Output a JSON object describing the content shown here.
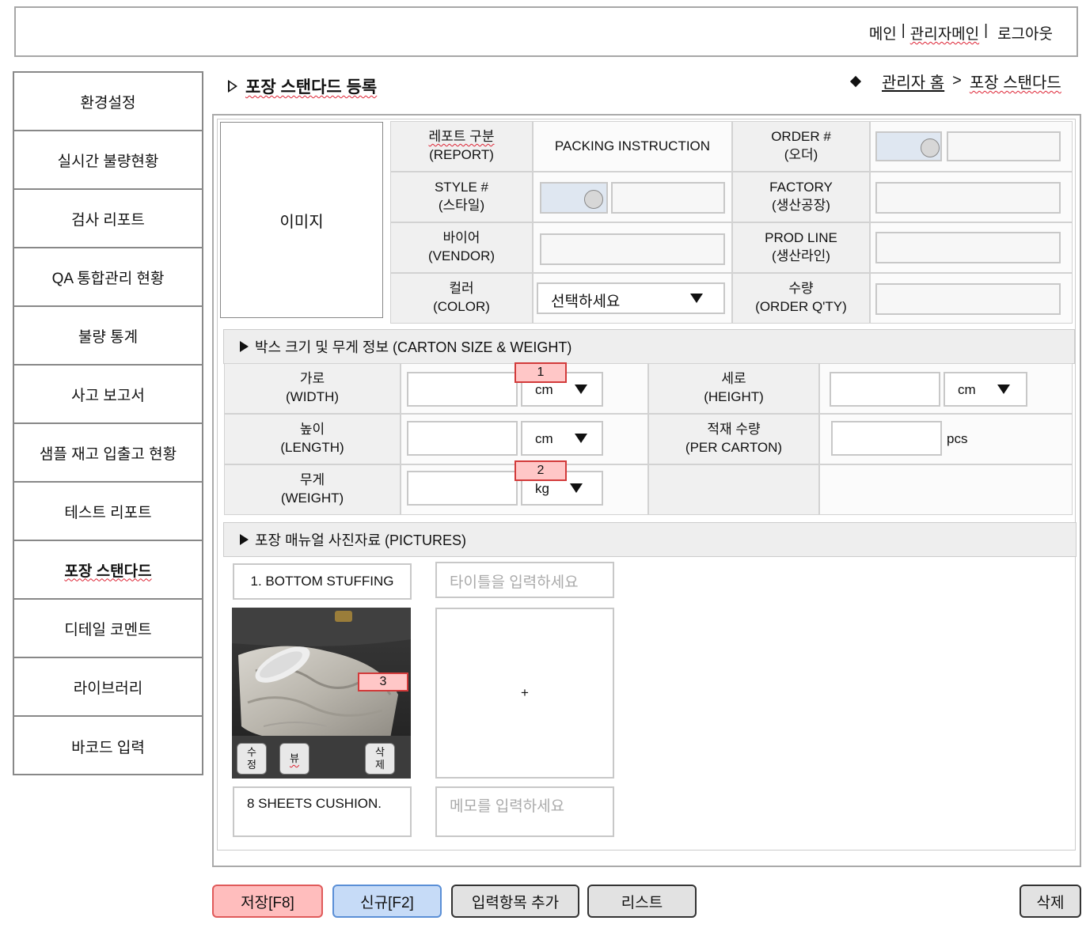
{
  "header": {
    "links": [
      "메인",
      "관리자메인",
      "로그아웃"
    ],
    "separator": "|"
  },
  "sidebar": {
    "items": [
      {
        "label": "환경설정",
        "active": false
      },
      {
        "label": "실시간 불량현황",
        "active": false
      },
      {
        "label": "검사 리포트",
        "active": false
      },
      {
        "label": "QA 통합관리 현황",
        "active": false
      },
      {
        "label": "불량 통계",
        "active": false
      },
      {
        "label": "사고 보고서",
        "active": false
      },
      {
        "label": "샘플 재고 입출고 현황",
        "active": false
      },
      {
        "label": "테스트 리포트",
        "active": false
      },
      {
        "label": "포장 스탠다드",
        "active": true
      },
      {
        "label": "디테일 코멘트",
        "active": false
      },
      {
        "label": "라이브러리",
        "active": false
      },
      {
        "label": "바코드 입력",
        "active": false
      }
    ]
  },
  "page": {
    "title": "포장 스탠다드 등록",
    "breadcrumb": {
      "home": "관리자 홈",
      "separator": ">",
      "current": "포장 스탠다드"
    }
  },
  "form": {
    "image_label": "이미지",
    "report_label_1": "레포트 구분",
    "report_label_2": "(REPORT)",
    "report_value": "PACKING INSTRUCTION",
    "order_label_1": "ORDER #",
    "order_label_2": "(오더)",
    "style_label_1": "STYLE #",
    "style_label_2": "(스타일)",
    "factory_label_1": "FACTORY",
    "factory_label_2": "(생산공장)",
    "vendor_label_1": "바이어",
    "vendor_label_2": "(VENDOR)",
    "prodline_label_1": "PROD LINE",
    "prodline_label_2": "(생산라인)",
    "color_label_1": "컬러",
    "color_label_2": "(COLOR)",
    "color_select": "선택하세요",
    "qty_label_1": "수량",
    "qty_label_2": "(ORDER Q'TY)"
  },
  "carton": {
    "header": "박스 크기 및 무게 정보 (CARTON SIZE & WEIGHT)",
    "width_label_1": "가로",
    "width_label_2": "(WIDTH)",
    "width_unit": "cm",
    "height_label_1": "세로",
    "height_label_2": "(HEIGHT)",
    "height_unit": "cm",
    "length_label_1": "높이",
    "length_label_2": "(LENGTH)",
    "length_unit": "cm",
    "per_carton_label_1": "적재 수량",
    "per_carton_label_2": "(PER CARTON)",
    "per_carton_unit": "pcs",
    "weight_label_1": "무게",
    "weight_label_2": "(WEIGHT)",
    "weight_unit": "kg"
  },
  "badges": {
    "b1": "1",
    "b2": "2",
    "b3": "3"
  },
  "pictures": {
    "header": "포장 매뉴얼 사진자료 (PICTURES)",
    "item1_title": "1. BOTTOM STUFFING",
    "item1_memo": "8 SHEETS CUSHION.",
    "edit_btn_1": "수",
    "edit_btn_2": "정",
    "view_btn": "뷰",
    "delete_btn_1": "삭",
    "delete_btn_2": "제",
    "title_placeholder": "타이틀을 입력하세요",
    "add_symbol": "+",
    "memo_placeholder": "메모를 입력하세요"
  },
  "footer": {
    "save": "저장[F8]",
    "new": "신규[F2]",
    "add_field": "입력항목 추가",
    "list": "리스트",
    "delete": "삭제"
  },
  "colors": {
    "save_bg": "#ffbdbd",
    "new_bg": "#c6dbf7",
    "badge_bg": "#ffc7c7",
    "badge_border": "#d23a3a"
  }
}
